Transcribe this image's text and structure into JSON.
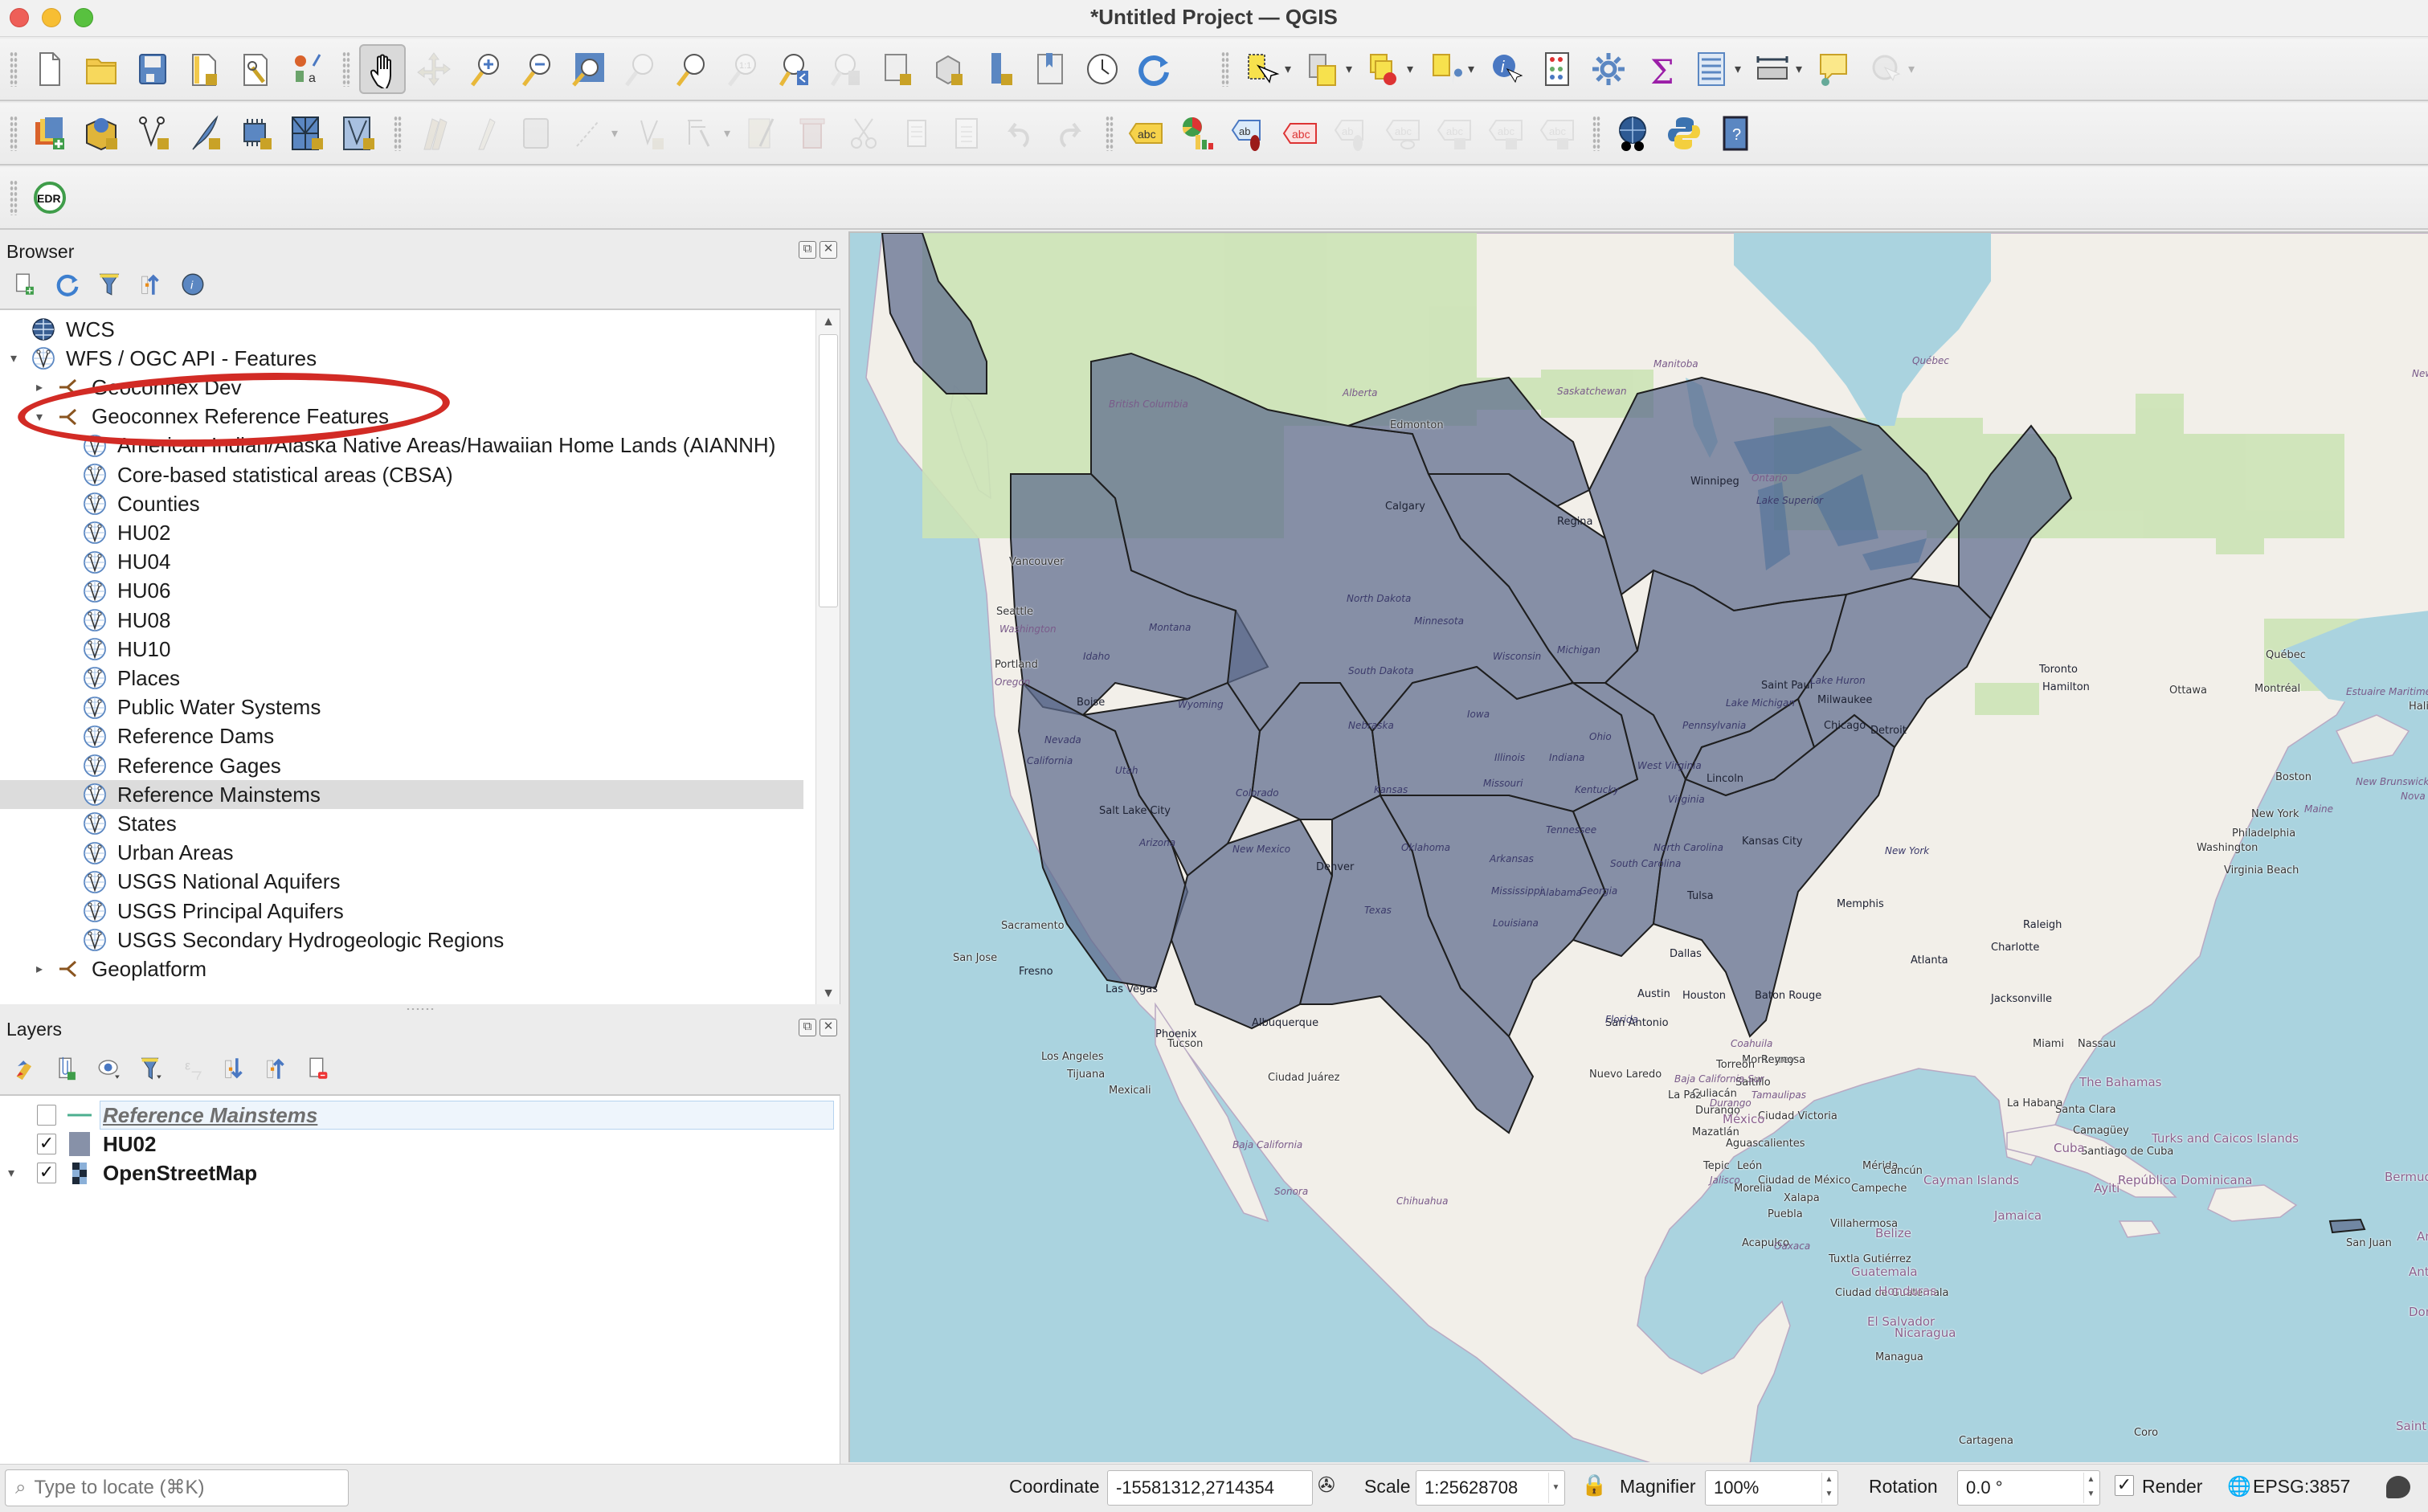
{
  "window": {
    "title": "*Untitled Project — QGIS"
  },
  "toolbars": {
    "project": [
      {
        "name": "new-project",
        "label": "New Project"
      },
      {
        "name": "open-project",
        "label": "Open Project"
      },
      {
        "name": "save-project",
        "label": "Save Project"
      },
      {
        "name": "new-print-layout",
        "label": "New Print Layout"
      },
      {
        "name": "layout-manager",
        "label": "Layout Manager"
      },
      {
        "name": "style-manager",
        "label": "Style Manager"
      }
    ],
    "navigation": [
      {
        "name": "pan-map",
        "label": "Pan Map",
        "active": true
      },
      {
        "name": "pan-to-selection",
        "label": "Pan Map to Selection",
        "disabled": true
      },
      {
        "name": "zoom-in",
        "label": "Zoom In"
      },
      {
        "name": "zoom-out",
        "label": "Zoom Out"
      },
      {
        "name": "zoom-full",
        "label": "Zoom Full"
      },
      {
        "name": "zoom-to-selection",
        "label": "Zoom to Selection",
        "disabled": true
      },
      {
        "name": "zoom-to-layer",
        "label": "Zoom to Layer"
      },
      {
        "name": "zoom-native",
        "label": "Zoom to Native Resolution",
        "disabled": true
      },
      {
        "name": "zoom-last",
        "label": "Zoom Last"
      },
      {
        "name": "zoom-next",
        "label": "Zoom Next",
        "disabled": true
      },
      {
        "name": "new-map-view",
        "label": "New Map View"
      },
      {
        "name": "new-3d-map-view",
        "label": "New 3D Map View"
      },
      {
        "name": "new-spatial-bookmark",
        "label": "New Spatial Bookmark"
      },
      {
        "name": "show-spatial-bookmarks",
        "label": "Show Spatial Bookmarks"
      },
      {
        "name": "temporal-controller",
        "label": "Temporal Controller"
      },
      {
        "name": "refresh",
        "label": "Refresh"
      }
    ],
    "attributes": [
      {
        "name": "select-features",
        "label": "Select Features",
        "dropdown": true
      },
      {
        "name": "select-by-value",
        "label": "Select by Value",
        "dropdown": true
      },
      {
        "name": "deselect-all",
        "label": "Deselect All",
        "dropdown": true
      },
      {
        "name": "select-by-location",
        "label": "Select by Location",
        "dropdown": true
      },
      {
        "name": "identify-features",
        "label": "Identify Features"
      },
      {
        "name": "open-field-calculator",
        "label": "Open Field Calculator"
      },
      {
        "name": "processing-toolbox",
        "label": "Toolbox"
      },
      {
        "name": "statistical-summary",
        "label": "Statistical Summary"
      },
      {
        "name": "open-attribute-table",
        "label": "Open Attribute Table",
        "dropdown": true
      },
      {
        "name": "measure-line",
        "label": "Measure Line",
        "dropdown": true
      },
      {
        "name": "map-tips",
        "label": "Show Map Tips"
      },
      {
        "name": "run-feature-action",
        "label": "Run Feature Action",
        "dropdown": true,
        "disabled": true
      }
    ],
    "data_source": [
      {
        "name": "data-source-manager",
        "label": "Open Data Source Manager"
      },
      {
        "name": "new-geopackage-layer",
        "label": "New GeoPackage Layer"
      },
      {
        "name": "new-shapefile-layer",
        "label": "New Shapefile Layer"
      },
      {
        "name": "new-temporary-scratch-layer",
        "label": "New Temporary Scratch Layer"
      },
      {
        "name": "new-virtual-layer",
        "label": "New Virtual Layer"
      },
      {
        "name": "new-mesh-layer",
        "label": "New Mesh Layer"
      },
      {
        "name": "new-gps-layer",
        "label": "New GPX Layer"
      }
    ],
    "digitizing": [
      {
        "name": "current-edits",
        "label": "Current Edits",
        "disabled": true
      },
      {
        "name": "toggle-editing",
        "label": "Toggle Editing",
        "disabled": true
      },
      {
        "name": "save-layer-edits",
        "label": "Save Layer Edits",
        "disabled": true
      },
      {
        "name": "add-feature",
        "label": "Add Feature",
        "disabled": true,
        "dropdown": true
      },
      {
        "name": "vertex-tool",
        "label": "Vertex Tool",
        "disabled": true
      },
      {
        "name": "modify-attributes",
        "label": "Modify Attributes",
        "disabled": true,
        "dropdown": true
      },
      {
        "name": "multi-edit",
        "label": "Modify Attributes of Selected Features",
        "disabled": true
      },
      {
        "name": "delete-selected",
        "label": "Delete Selected",
        "disabled": true
      },
      {
        "name": "cut-features",
        "label": "Cut Features",
        "disabled": true
      },
      {
        "name": "copy-features",
        "label": "Copy Features",
        "disabled": true
      },
      {
        "name": "paste-features",
        "label": "Paste Features",
        "disabled": true
      },
      {
        "name": "undo",
        "label": "Undo",
        "disabled": true
      },
      {
        "name": "redo",
        "label": "Redo",
        "disabled": true
      }
    ],
    "labels": [
      {
        "name": "layer-labeling-options",
        "label": "Layer Labeling Options"
      },
      {
        "name": "layer-diagram-options",
        "label": "Layer Diagram Options"
      },
      {
        "name": "highlight-pinned-labels",
        "label": "Highlight Pinned Labels"
      },
      {
        "name": "toggle-display-unplaced-labels",
        "label": "Toggle Display of Unplaced Labels"
      },
      {
        "name": "pin-unpin-labels",
        "label": "Pin/Unpin Labels",
        "disabled": true
      },
      {
        "name": "show-hide-labels",
        "label": "Show/Hide Labels",
        "disabled": true
      },
      {
        "name": "move-label",
        "label": "Move Label",
        "disabled": true
      },
      {
        "name": "rotate-label",
        "label": "Rotate Label",
        "disabled": true
      },
      {
        "name": "change-label-properties",
        "label": "Change Label Properties",
        "disabled": true
      }
    ],
    "plugins": [
      {
        "name": "metasearch",
        "label": "Metasearch Catalog Client"
      },
      {
        "name": "python-console",
        "label": "Python Console"
      },
      {
        "name": "help-contents",
        "label": "Help Contents"
      }
    ],
    "extra": [
      {
        "name": "edr-plugin",
        "label": "EDR",
        "text": "EDR"
      }
    ]
  },
  "browser": {
    "title": "Browser",
    "tools": [
      "add-selected-layers",
      "refresh",
      "filter-browser",
      "collapse-all",
      "enable-properties"
    ],
    "tree": [
      {
        "label": "WCS",
        "icon": "globe-icon",
        "level": 0,
        "arrow": ""
      },
      {
        "label": "WFS / OGC API - Features",
        "icon": "wfs-icon",
        "level": 0,
        "arrow": "expanded"
      },
      {
        "label": "Geoconnex Dev",
        "icon": "connection-icon",
        "level": 1,
        "arrow": "collapsed"
      },
      {
        "label": "Geoconnex Reference Features",
        "icon": "connection-icon",
        "level": 1,
        "arrow": "expanded"
      },
      {
        "label": "American Indian/Alaska Native Areas/Hawaiian Home Lands (AIANNH)",
        "icon": "wfs-icon",
        "level": 2,
        "arrow": ""
      },
      {
        "label": "Core-based statistical areas (CBSA)",
        "icon": "wfs-icon",
        "level": 2,
        "arrow": ""
      },
      {
        "label": "Counties",
        "icon": "wfs-icon",
        "level": 2,
        "arrow": ""
      },
      {
        "label": "HU02",
        "icon": "wfs-icon",
        "level": 2,
        "arrow": ""
      },
      {
        "label": "HU04",
        "icon": "wfs-icon",
        "level": 2,
        "arrow": ""
      },
      {
        "label": "HU06",
        "icon": "wfs-icon",
        "level": 2,
        "arrow": ""
      },
      {
        "label": "HU08",
        "icon": "wfs-icon",
        "level": 2,
        "arrow": ""
      },
      {
        "label": "HU10",
        "icon": "wfs-icon",
        "level": 2,
        "arrow": ""
      },
      {
        "label": "Places",
        "icon": "wfs-icon",
        "level": 2,
        "arrow": ""
      },
      {
        "label": "Public Water Systems",
        "icon": "wfs-icon",
        "level": 2,
        "arrow": ""
      },
      {
        "label": "Reference Dams",
        "icon": "wfs-icon",
        "level": 2,
        "arrow": ""
      },
      {
        "label": "Reference Gages",
        "icon": "wfs-icon",
        "level": 2,
        "arrow": ""
      },
      {
        "label": "Reference Mainstems",
        "icon": "wfs-icon",
        "level": 2,
        "arrow": "",
        "selected": true
      },
      {
        "label": "States",
        "icon": "wfs-icon",
        "level": 2,
        "arrow": ""
      },
      {
        "label": "Urban Areas",
        "icon": "wfs-icon",
        "level": 2,
        "arrow": ""
      },
      {
        "label": "USGS National Aquifers",
        "icon": "wfs-icon",
        "level": 2,
        "arrow": ""
      },
      {
        "label": "USGS Principal Aquifers",
        "icon": "wfs-icon",
        "level": 2,
        "arrow": ""
      },
      {
        "label": "USGS Secondary Hydrogeologic Regions",
        "icon": "wfs-icon",
        "level": 2,
        "arrow": ""
      },
      {
        "label": "Geoplatform",
        "icon": "connection-icon",
        "level": 1,
        "arrow": "collapsed"
      }
    ]
  },
  "layers": {
    "title": "Layers",
    "tools": [
      "open-layer-styling-panel",
      "add-group",
      "manage-map-themes",
      "filter-legend",
      "filter-legend-by-expression",
      "expand-all",
      "collapse-all",
      "remove-layer"
    ],
    "items": [
      {
        "label": "Reference Mainstems",
        "checked": false,
        "symbol": "line",
        "editing": true
      },
      {
        "label": "HU02",
        "checked": true,
        "symbol": "polygon",
        "editing": false
      },
      {
        "label": "OpenStreetMap",
        "checked": true,
        "symbol": "raster",
        "editing": false,
        "arrow": "expanded"
      }
    ],
    "colors": {
      "line_symbol": "#4caf8f",
      "polygon_symbol": "#8791a8"
    }
  },
  "map": {
    "colors": {
      "water": "#aad3df",
      "land": "#f2efe9",
      "forest": "#cce3b6",
      "hu02_fill": "#5c6a8c",
      "annotation": "#d22b25"
    },
    "labels": {
      "cities": [
        "Edmonton",
        "Calgary",
        "Regina",
        "Winnipeg",
        "Vancouver",
        "Seattle",
        "Portland",
        "Boise",
        "Salt Lake City",
        "Denver",
        "Sacramento",
        "San Jose",
        "Fresno",
        "Las Vegas",
        "Los Angeles",
        "Tijuana",
        "Mexicali",
        "Phoenix",
        "Tucson",
        "Albuquerque",
        "Ciudad Juárez",
        "Saint Paul",
        "Lincoln",
        "Kansas City",
        "Tulsa",
        "Dallas",
        "Austin",
        "San Antonio",
        "Houston",
        "Nuevo Laredo",
        "Baton Rouge",
        "Memphis",
        "Atlanta",
        "Charlotte",
        "Raleigh",
        "Jacksonville",
        "Milwaukee",
        "Chicago",
        "Detroit",
        "Toronto",
        "Hamilton",
        "Ottawa",
        "Montréal",
        "Québec",
        "Halifax",
        "Boston",
        "New York",
        "Philadelphia",
        "Washington",
        "Virginia Beach",
        "Miami",
        "Nassau",
        "La Habana",
        "Santa Clara",
        "Camagüey",
        "Santiago de Cuba",
        "San Juan",
        "Monterrey",
        "Reynosa",
        "Saltillo",
        "Torreón",
        "Durango",
        "Culiacán",
        "Mazatlán",
        "La Paz",
        "Aguascalientes",
        "Tepic",
        "León",
        "Morelia",
        "Ciudad de México",
        "Puebla",
        "Xalapa",
        "Acapulco",
        "Ciudad Victoria",
        "Mérida",
        "Cancún",
        "Campeche",
        "Villahermosa",
        "Tuxtla Gutiérrez",
        "Ciudad de Guatemala",
        "Managua",
        "Coro",
        "Cartagena"
      ],
      "regions": [
        "British Columbia",
        "Alberta",
        "Saskatchewan",
        "Manitoba",
        "Ontario",
        "Québec",
        "Newfoundland and Labrador",
        "Washington",
        "Oregon",
        "Idaho",
        "Montana",
        "Wyoming",
        "Nevada",
        "Utah",
        "California",
        "Arizona",
        "New Mexico",
        "Colorado",
        "North Dakota",
        "South Dakota",
        "Nebraska",
        "Kansas",
        "Oklahoma",
        "Texas",
        "Minnesota",
        "Iowa",
        "Missouri",
        "Arkansas",
        "Louisiana",
        "Wisconsin",
        "Illinois",
        "Michigan",
        "Indiana",
        "Ohio",
        "Kentucky",
        "Tennessee",
        "Mississippi",
        "Alabama",
        "Georgia",
        "South Carolina",
        "North Carolina",
        "Florida",
        "West Virginia",
        "Virginia",
        "Pennsylvania",
        "New York",
        "Maine",
        "Lake Superior",
        "Lake Michigan",
        "Lake Huron",
        "Baja California",
        "Baja California Sur",
        "Sonora",
        "Chihuahua",
        "Coahuila",
        "Durango",
        "Tamaulipas",
        "Jalisco",
        "Oaxaca",
        "Estuaire Maritime du Fleuve Saint-Laurent",
        "New Brunswick / Nouveau-Brunswick",
        "Nova Scotia"
      ],
      "countries": [
        "México",
        "The Bahamas",
        "Cuba",
        "Cayman Islands",
        "Jamaica",
        "Ayiti",
        "República Dominicana",
        "Turks and Caicos Islands",
        "Belize",
        "Guatemala",
        "Honduras",
        "El Salvador",
        "Nicaragua",
        "Bermuda",
        "Anguilla",
        "Antigua and Barbuda",
        "Dominica",
        "Saint Vincent and the Grenadines"
      ]
    }
  },
  "statusbar": {
    "locator_placeholder": "Type to locate (⌘K)",
    "coordinate_label": "Coordinate",
    "coordinate_value": "-15581312,2714354",
    "scale_label": "Scale",
    "scale_value": "1:25628708",
    "magnifier_label": "Magnifier",
    "magnifier_value": "100%",
    "rotation_label": "Rotation",
    "rotation_value": "0.0 °",
    "render_label": "Render",
    "render_checked": true,
    "crs_label": "EPSG:3857"
  }
}
